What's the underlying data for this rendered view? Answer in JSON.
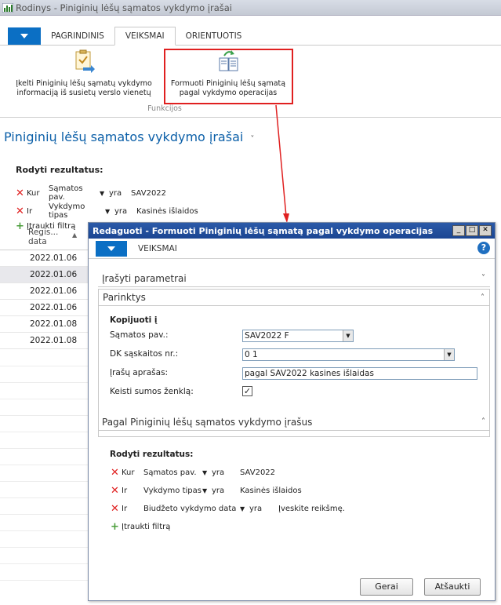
{
  "window": {
    "title": "Rodinys - Piniginių lėšų sąmatos vykdymo įrašai"
  },
  "tabs": [
    "PAGRINDINIS",
    "VEIKSMAI",
    "ORIENTUOTIS"
  ],
  "ribbon": {
    "button1": [
      "Įkelti Piniginių lėšų sąmatų vykdymo",
      "informaciją iš susietų verslo vienetų"
    ],
    "button2": [
      "Formuoti Piniginių lėšų sąmatą",
      "pagal vykdymo operacijas"
    ],
    "group_label": "Funkcijos"
  },
  "page": {
    "title": "Piniginių lėšų sąmatos vykdymo įrašai",
    "title_arrow": "˅",
    "filters_title": "Rodyti rezultatus:",
    "filters": [
      {
        "op": "Kur",
        "field": "Sąmatos pav.",
        "cmp": "yra",
        "value": "SAV2022"
      },
      {
        "op": "Ir",
        "field": "Vykdymo tipas",
        "cmp": "yra",
        "value": "Kasinės išlaidos"
      }
    ],
    "add_filter": "Įtraukti filtrą",
    "column_header": [
      "Regis...",
      "data"
    ],
    "dates": [
      "2022.01.06",
      "2022.01.06",
      "2022.01.06",
      "2022.01.06",
      "2022.01.08",
      "2022.01.08"
    ]
  },
  "dialog": {
    "title": "Redaguoti - Formuoti Piniginių lėšų sąmatą pagal vykdymo operacijas",
    "tab": "VEIKSMAI",
    "sections": {
      "params": "Įrašyti parametrai",
      "options": "Parinktys",
      "records": "Pagal Piniginių lėšų sąmatos vykdymo įrašus"
    },
    "copy_to": "Kopijuoti į",
    "fields": [
      {
        "label": "Sąmatos pav.:",
        "value": "SAV2022 F"
      },
      {
        "label": "DK sąskaitos nr.:",
        "value": "0 1"
      },
      {
        "label": "Įrašų aprašas:",
        "value": "pagal SAV2022 kasines išlaidas"
      },
      {
        "label": "Keisti sumos ženklą:",
        "value": "✓"
      }
    ],
    "filters_title": "Rodyti rezultatus:",
    "filters": [
      {
        "op": "Kur",
        "field": "Sąmatos pav.",
        "cmp": "yra",
        "value": "SAV2022"
      },
      {
        "op": "Ir",
        "field": "Vykdymo tipas",
        "cmp": "yra",
        "value": "Kasinės išlaidos"
      },
      {
        "op": "Ir",
        "field": "Biudžeto vykdymo data",
        "cmp": "yra",
        "value": "Įveskite reikšmę."
      }
    ],
    "add_filter": "Įtraukti filtrą",
    "ok": "Gerai",
    "cancel": "Atšaukti"
  },
  "colors": {
    "accent": "#0b6fc4",
    "highlight": "#e02020",
    "title_blue": "#0b5fa8"
  }
}
